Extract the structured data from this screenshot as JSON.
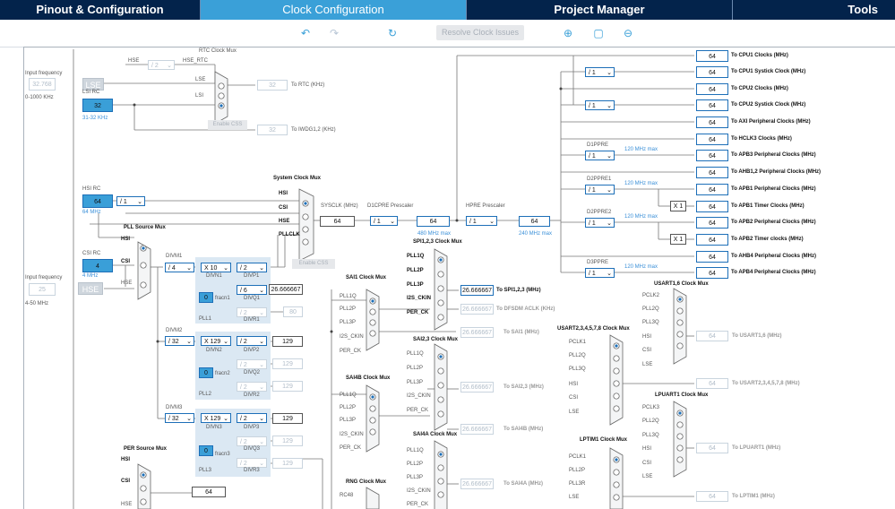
{
  "tabs": [
    {
      "label": "Pinout & Configuration"
    },
    {
      "label": "Clock Configuration"
    },
    {
      "label": "Project Manager"
    },
    {
      "label": "Tools"
    }
  ],
  "toolbar": {
    "resolve_label": "Resolve Clock Issues"
  },
  "colors": {
    "header": "#03234b",
    "active_tab": "#3aa0d8",
    "box_border": "#1d6fb8",
    "pll_bg": "#dbe8f3"
  },
  "labels": {
    "input_freq_1": "Input frequency",
    "lse_val": "32.768",
    "lse_range": "0-1000 KHz",
    "lse": "LSE",
    "lsi_rc": "LSI RC",
    "lsi_val": "32",
    "lsi_range": "31-32 KHz",
    "input_freq_2": "Input frequency",
    "hse_val": "25",
    "hse_range": "4-50 MHz",
    "hse": "HSE",
    "hsi_rc": "HSI RC",
    "hsi_val": "64",
    "hsi_freq": "64 MHz",
    "hsi_div": "/ 1",
    "csi_rc": "CSI RC",
    "csi_val": "4",
    "csi_freq": "4 MHz",
    "rtc_mux": "RTC Clock Mux",
    "rtc_hse": "HSE",
    "rtc_div": "/ 2",
    "hse_rtc": "HSE_RTC",
    "rtc_lse": "LSE",
    "rtc_lsi": "LSI",
    "rtc_val": "32",
    "to_rtc": "To RTC (KHz)",
    "enable_css": "Enable CSS",
    "iwdg_val": "32",
    "to_iwdg": "To IWDG1,2 (KHz)",
    "sys_mux": "System Clock Mux",
    "sys_hsi": "HSI",
    "sys_csi": "CSI",
    "sys_hse": "HSE",
    "pllclk": "PLLCLK",
    "enable_css2": "Enable CSS",
    "sysclk": "SYSCLK (MHz)",
    "sysclk_val": "64",
    "d1cpre": "D1CPRE Prescaler",
    "d1cpre_div": "/ 1",
    "d1cpre_val": "64",
    "max480": "480 MHz max",
    "hpre": "HPRE Prescaler",
    "hpre_div": "/ 1",
    "hpre_val": "64",
    "max240": "240 MHz max",
    "pll_mux": "PLL Source Mux",
    "pll_hsi": "HSI",
    "pll_csi": "CSI",
    "pll_hse": "HSE",
    "divm1": "DIVM1",
    "divm1_val": "/ 4",
    "divn1": "DIVN1",
    "divn1_val": "X 10",
    "divp1": "DIVP1",
    "divp1_val": "/ 2",
    "divq1": "DIVQ1",
    "divq1_val": "/ 6",
    "divr1": "DIVR1",
    "divr1_val": "/ 2",
    "fracn1": "fracn1",
    "fracn1_val": "0",
    "pll1": "PLL1",
    "pll1_q_out": "26.666667",
    "pll1_r_out": "80",
    "divm2": "DIVM2",
    "divm2_val": "/ 32",
    "divn2": "DIVN2",
    "divn2_val": "X 129",
    "divp2": "DIVP2",
    "divp2_val": "/ 2",
    "divq2": "DIVQ2",
    "divq2_val": "/ 2",
    "divr2": "DIVR2",
    "divr2_val": "/ 2",
    "fracn2": "fracn2",
    "fracn2_val": "0",
    "pll2": "PLL2",
    "pll2_p_out": "129",
    "pll2_q_out": "129",
    "pll2_r_out": "129",
    "divm3": "DIVM3",
    "divm3_val": "/ 32",
    "divn3": "DIVN3",
    "divn3_val": "X 129",
    "divp3": "DIVP3",
    "divp3_val": "/ 2",
    "divq3": "DIVQ3",
    "divq3_val": "/ 2",
    "divr3": "DIVR3",
    "divr3_val": "/ 2",
    "fracn3": "fracn3",
    "fracn3_val": "0",
    "pll3": "PLL3",
    "pll3_p_out": "129",
    "pll3_q_out": "129",
    "pll3_r_out": "129",
    "per_mux": "PER Source Mux",
    "per_hsi": "HSI",
    "per_csi": "CSI",
    "per_hse": "HSE",
    "per_val": "64",
    "spi_mux": "SPI1,2,3 Clock Mux",
    "spi_pll1q": "PLL1Q",
    "spi_pll2p": "PLL2P",
    "spi_pll3p": "PLL3P",
    "spi_i2s": "I2S_CKIN",
    "spi_per": "PER_CK",
    "spi_val": "26.666667",
    "to_spi": "To SPI1,2,3 (MHz)",
    "dfsdm_val": "26.666667",
    "to_dfsdm": "To DFSDM ACLK (KHz)",
    "sai1_mux": "SAI1 Clock Mux",
    "sai1_pll1q": "PLL1Q",
    "sai1_pll2p": "PLL2P",
    "sai1_pll3p": "PLL3P",
    "sai1_i2s": "I2S_CKIN",
    "sai1_per": "PER_CK",
    "sai1_val": "26.666667",
    "to_sai1": "To SAI1 (MHz)",
    "sai23_mux": "SAI2,3 Clock Mux",
    "sai23_pll1q": "PLL1Q",
    "sai23_pll2p": "PLL2P",
    "sai23_pll3p": "PLL3P",
    "sai23_i2s": "I2S_CKIN",
    "sai23_per": "PER_CK",
    "sai23_val": "26.666667",
    "to_sai23": "To SAI2,3 (MHz)",
    "sai4b_mux": "SAI4B Clock Mux",
    "sai4b_pll1q": "PLL1Q",
    "sai4b_pll2p": "PLL2P",
    "sai4b_pll3p": "PLL3P",
    "sai4b_i2s": "I2S_CKIN",
    "sai4b_per": "PER_CK",
    "sai4b_val": "26.666667",
    "to_sai4b": "To SAI4B (MHz)",
    "sai4a_mux": "SAI4A Clock Mux",
    "sai4a_pll1q": "PLL1Q",
    "sai4a_pll2p": "PLL2P",
    "sai4a_pll3p": "PLL3P",
    "sai4a_i2s": "I2S_CKIN",
    "sai4a_per": "PER_CK",
    "sai4a_val": "26.666667",
    "to_sai4a": "To SAI4A (MHz)",
    "rng_mux": "RNG Clock Mux",
    "rng_rc48": "RC48",
    "usart16_mux": "USART1,6 Clock Mux",
    "u16_pclk2": "PCLK2",
    "u16_pll2q": "PLL2Q",
    "u16_pll3q": "PLL3Q",
    "u16_hsi": "HSI",
    "u16_csi": "CSI",
    "u16_lse": "LSE",
    "u16_val": "64",
    "to_u16": "To USART1,6 (MHz)",
    "usart2_mux": "USART2,3,4,5,7,8 Clock Mux",
    "u2_pclk1": "PCLK1",
    "u2_pll2q": "PLL2Q",
    "u2_pll3q": "PLL3Q",
    "u2_hsi": "HSI",
    "u2_csi": "CSI",
    "u2_lse": "LSE",
    "u2_val": "64",
    "to_u2": "To USART2,3,4,5,7,8 (MHz)",
    "lpuart_mux": "LPUART1 Clock Mux",
    "lp_pclk3": "PCLK3",
    "lp_pll2q": "PLL2Q",
    "lp_pll3q": "PLL3Q",
    "lp_hsi": "HSI",
    "lp_csi": "CSI",
    "lp_lse": "LSE",
    "lp_val": "64",
    "to_lp": "To LPUART1 (MHz)",
    "lptim_mux": "LPTIM1 Clock Mux",
    "lt_pclk1": "PCLK1",
    "lt_pll2p": "PLL2P",
    "lt_pll3r": "PLL3R",
    "lt_lse": "LSE",
    "lt_lsi": "LSI",
    "lt_per": "PER_CK",
    "lt_val": "64",
    "to_lt": "To LPTIM1 (MHz)"
  },
  "right_outputs": [
    {
      "value": "64",
      "label": "To CPU1 Clocks (MHz)"
    },
    {
      "value": "64",
      "label": "To CPU1 Systick Clock (MHz)"
    },
    {
      "value": "64",
      "label": "To CPU2 Clocks (MHz)"
    },
    {
      "value": "64",
      "label": "To CPU2 Systick Clock (MHz)"
    },
    {
      "value": "64",
      "label": "To AXI Peripheral Clocks (MHz)"
    },
    {
      "value": "64",
      "label": "To HCLK3 Clocks (MHz)"
    },
    {
      "value": "64",
      "label": "To APB3 Peripheral Clocks (MHz)"
    },
    {
      "value": "64",
      "label": "To AHB1,2 Peripheral Clocks (MHz)"
    },
    {
      "value": "64",
      "label": "To APB1 Peripheral Clocks (MHz)"
    },
    {
      "value": "64",
      "label": "To APB1 Timer Clocks (MHz)"
    },
    {
      "value": "64",
      "label": "To APB2 Peripheral Clocks (MHz)"
    },
    {
      "value": "64",
      "label": "To APB2 Timer clocks (MHz)"
    },
    {
      "value": "64",
      "label": "To AHB4 Peripheral Clocks (MHz)"
    },
    {
      "value": "64",
      "label": "To APB4 Peripheral Clocks (MHz)"
    }
  ],
  "right_prescalers": {
    "cpu1_systick": "/ 1",
    "cpu2_systick": "/ 1",
    "d1ppre": "D1PPRE",
    "d1ppre_div": "/ 1",
    "d1ppre_max": "120 MHz max",
    "d2ppre1": "D2PPRE1",
    "d2ppre1_div": "/ 1",
    "d2ppre1_max": "120 MHz max",
    "apb1_tim_mul": "X 1",
    "d2ppre2": "D2PPRE2",
    "d2ppre2_div": "/ 1",
    "d2ppre2_max": "120 MHz max",
    "apb2_tim_mul": "X 1",
    "d3ppre": "D3PPRE",
    "d3ppre_div": "/ 1",
    "d3ppre_max": "120 MHz max"
  }
}
